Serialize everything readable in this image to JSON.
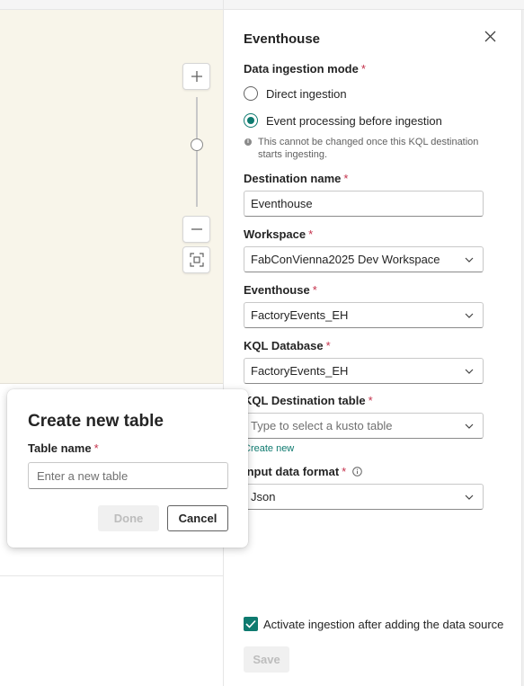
{
  "canvas": {
    "zoom_in_icon": "plus-icon",
    "zoom_out_icon": "minus-icon",
    "fit_icon": "fit-to-screen-icon",
    "zoom_level": 0.55
  },
  "panel": {
    "title": "Eventhouse",
    "close_icon": "close-icon",
    "ingestion_mode": {
      "label": "Data ingestion mode",
      "required_mark": "*",
      "options": [
        {
          "label": "Direct ingestion",
          "selected": false
        },
        {
          "label": "Event processing before ingestion",
          "selected": true
        }
      ],
      "note": "This cannot be changed once this KQL destination starts ingesting."
    },
    "destination_name": {
      "label": "Destination name",
      "required_mark": "*",
      "value": "Eventhouse"
    },
    "workspace": {
      "label": "Workspace",
      "required_mark": "*",
      "value": "FabConVienna2025 Dev Workspace"
    },
    "eventhouse": {
      "label": "Eventhouse",
      "required_mark": "*",
      "value": "FactoryEvents_EH"
    },
    "kql_database": {
      "label": "KQL Database",
      "required_mark": "*",
      "value": "FactoryEvents_EH"
    },
    "kql_table": {
      "label": "KQL Destination table",
      "required_mark": "*",
      "placeholder": "Type to select a kusto table",
      "create_new": "Create new"
    },
    "input_format": {
      "label": "Input data format",
      "required_mark": "*",
      "value": "Json"
    },
    "activate": {
      "label": "Activate ingestion after adding the data source",
      "checked": true
    },
    "save_label": "Save"
  },
  "dialog": {
    "title": "Create new table",
    "field_label": "Table name",
    "required_mark": "*",
    "placeholder": "Enter a new table",
    "done_label": "Done",
    "cancel_label": "Cancel"
  },
  "colors": {
    "accent": "#0e7a6f",
    "required": "#c4314b",
    "canvas_bg": "#f8f5ea"
  }
}
